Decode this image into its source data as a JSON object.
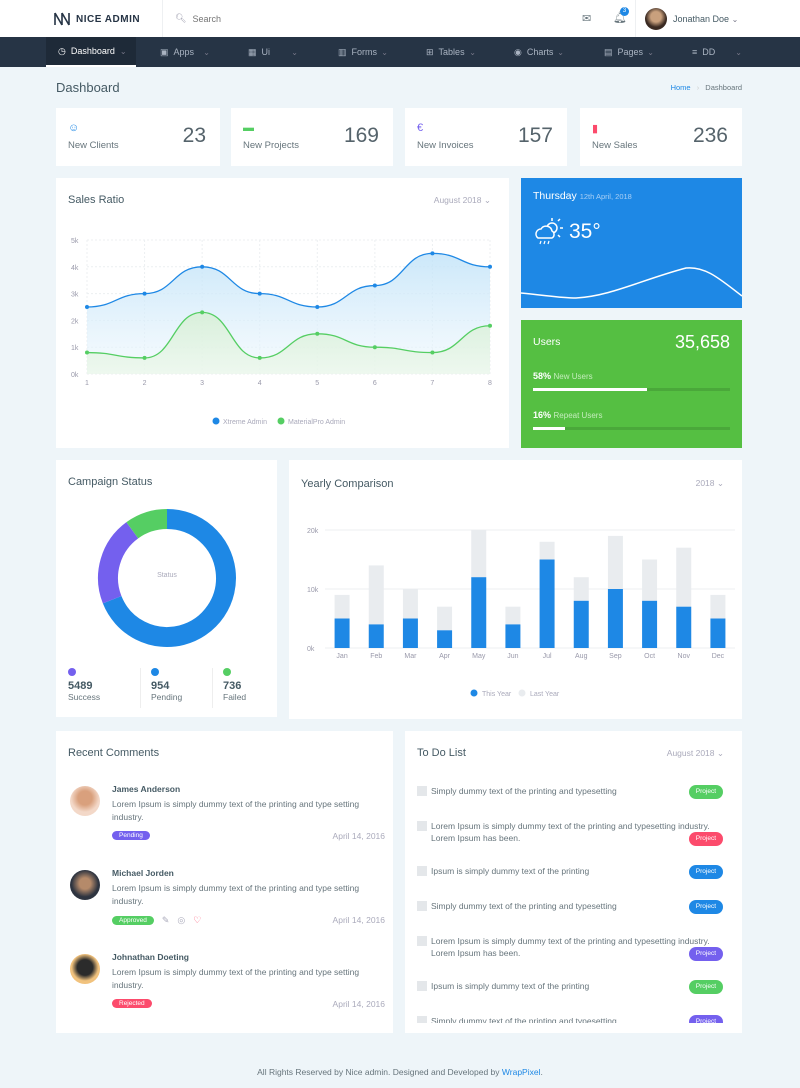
{
  "header": {
    "brand": "NICE ADMIN",
    "search_placeholder": "Search",
    "notif_count": "3",
    "user": "Jonathan Doe"
  },
  "nav": [
    {
      "label": "Dashboard",
      "icon": "dashboard-icon"
    },
    {
      "label": "Apps",
      "icon": "apps-icon"
    },
    {
      "label": "Ui",
      "icon": "ui-icon"
    },
    {
      "label": "Forms",
      "icon": "forms-icon"
    },
    {
      "label": "Tables",
      "icon": "tables-icon"
    },
    {
      "label": "Charts",
      "icon": "charts-icon"
    },
    {
      "label": "Pages",
      "icon": "pages-icon"
    },
    {
      "label": "DD",
      "icon": "menu-icon"
    }
  ],
  "page": {
    "title": "Dashboard",
    "breadcrumb": [
      "Home",
      "Dashboard"
    ]
  },
  "stats": [
    {
      "label": "New Clients",
      "value": "23",
      "icon": "smile-icon",
      "color": "#1e88e5"
    },
    {
      "label": "New Projects",
      "value": "169",
      "icon": "image-icon",
      "color": "#55ce63"
    },
    {
      "label": "New Invoices",
      "value": "157",
      "icon": "euro-icon",
      "color": "#7460ee"
    },
    {
      "label": "New Sales",
      "value": "236",
      "icon": "bar-chart-icon",
      "color": "#fc4b6c"
    }
  ],
  "sales": {
    "title": "Sales Ratio",
    "filter": "August 2018"
  },
  "weather": {
    "day": "Thursday",
    "date": "12th April, 2018",
    "temp": "35°",
    "icon": "cloud-sun-rain-icon"
  },
  "users": {
    "title": "Users",
    "total": "35,658",
    "new_pct": "58%",
    "new_label": "New Users",
    "new_value": 58,
    "repeat_pct": "16%",
    "repeat_label": "Repeat Users",
    "repeat_value": 16
  },
  "campaign": {
    "title": "Campaign Status",
    "center": "Status",
    "items": [
      {
        "value": "5489",
        "label": "Success",
        "color": "#7460ee"
      },
      {
        "value": "954",
        "label": "Pending",
        "color": "#1e88e5"
      },
      {
        "value": "736",
        "label": "Failed",
        "color": "#55ce63"
      }
    ]
  },
  "yearly": {
    "title": "Yearly Comparison",
    "filter": "2018"
  },
  "comments": {
    "title": "Recent Comments",
    "items": [
      {
        "name": "James Anderson",
        "text": "Lorem Ipsum is simply dummy text of the printing and type setting industry.",
        "status": "Pending",
        "color": "#7460ee",
        "date": "April 14, 2016"
      },
      {
        "name": "Michael Jorden",
        "text": "Lorem Ipsum is simply dummy text of the printing and type setting industry.",
        "status": "Approved",
        "color": "#55ce63",
        "date": "April 14, 2016"
      },
      {
        "name": "Johnathan Doeting",
        "text": "Lorem Ipsum is simply dummy text of the printing and type setting industry.",
        "status": "Rejected",
        "color": "#fc4b6c",
        "date": "April 14, 2016"
      }
    ]
  },
  "todo": {
    "title": "To Do List",
    "filter": "August 2018",
    "items": [
      {
        "text": "Simply dummy text of the printing and typesetting",
        "badge": "Project",
        "color": "#55ce63"
      },
      {
        "text": "Lorem Ipsum is simply dummy text of the printing and typesetting industry. Lorem Ipsum has been.",
        "badge": "Project",
        "color": "#fc4b6c"
      },
      {
        "text": "Ipsum is simply dummy text of the printing",
        "badge": "Project",
        "color": "#1e88e5"
      },
      {
        "text": "Simply dummy text of the printing and typesetting",
        "badge": "Project",
        "color": "#1e88e5"
      },
      {
        "text": "Lorem Ipsum is simply dummy text of the printing and typesetting industry. Lorem Ipsum has been.",
        "badge": "Project",
        "color": "#7460ee"
      },
      {
        "text": "Ipsum is simply dummy text of the printing",
        "badge": "Project",
        "color": "#55ce63"
      },
      {
        "text": "Simply dummy text of the printing and typesetting",
        "badge": "Project",
        "color": "#7460ee"
      }
    ]
  },
  "footer": {
    "text": "All Rights Reserved by Nice admin. Designed and Developed by ",
    "link": "WrapPixel",
    "end": "."
  },
  "chart_data": [
    {
      "type": "area",
      "x": [
        1,
        2,
        3,
        4,
        5,
        6,
        7,
        8
      ],
      "ylim": [
        0,
        5000
      ],
      "yticks": [
        "0k",
        "1k",
        "2k",
        "3k",
        "4k",
        "5k"
      ],
      "grid": true,
      "legend": "bottom",
      "series": [
        {
          "name": "Xtreme Admin",
          "color": "#1e88e5",
          "values": [
            2500,
            3000,
            4000,
            3000,
            2500,
            3300,
            4500,
            4000
          ]
        },
        {
          "name": "MaterialPro Admin",
          "color": "#55ce63",
          "values": [
            800,
            600,
            2300,
            600,
            1500,
            1000,
            800,
            1800
          ]
        }
      ]
    },
    {
      "type": "bar",
      "stacked": true,
      "categories": [
        "Jan",
        "Feb",
        "Mar",
        "Apr",
        "May",
        "Jun",
        "Jul",
        "Aug",
        "Sep",
        "Oct",
        "Nov",
        "Dec"
      ],
      "ylim": [
        0,
        20000
      ],
      "yticks": [
        "0k",
        "10k",
        "20k"
      ],
      "legend": "bottom",
      "series": [
        {
          "name": "This Year",
          "color": "#1e88e5",
          "values": [
            5000,
            4000,
            5000,
            3000,
            12000,
            4000,
            15000,
            8000,
            10000,
            8000,
            7000,
            5000
          ]
        },
        {
          "name": "Last Year",
          "color": "#e9ecef",
          "values": [
            4000,
            10000,
            5000,
            4000,
            8000,
            3000,
            3000,
            4000,
            9000,
            7000,
            10000,
            4000
          ]
        }
      ]
    },
    {
      "type": "pie",
      "donut": true,
      "labels": [
        "Pending",
        "Success",
        "Failed"
      ],
      "values": [
        69,
        21,
        10
      ],
      "colors": [
        "#1e88e5",
        "#7460ee",
        "#55ce63"
      ]
    }
  ]
}
